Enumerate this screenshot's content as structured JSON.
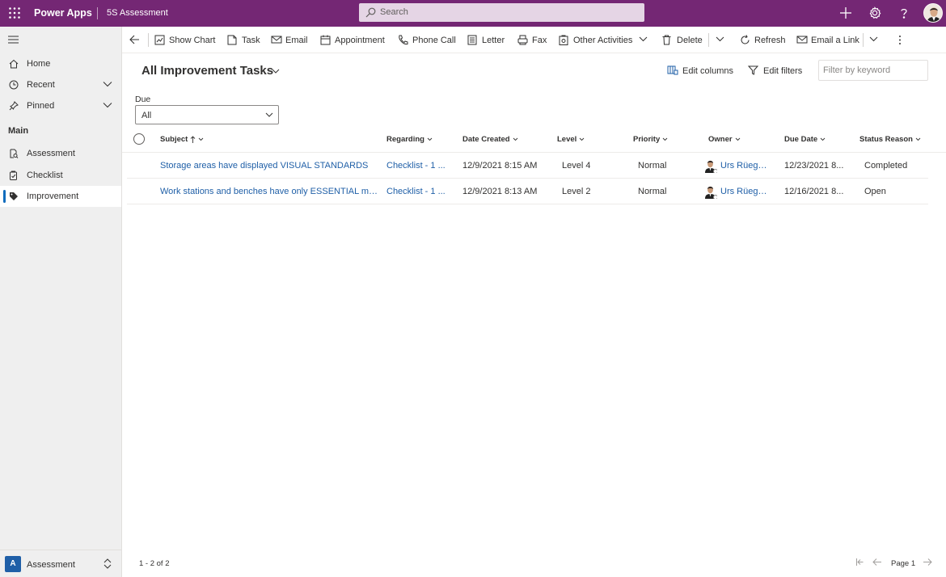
{
  "topbar": {
    "brand": "Power Apps",
    "app_name": "5S Assessment",
    "search_placeholder": "Search",
    "icons": [
      "waffle-icon",
      "plus-icon",
      "gear-icon",
      "help-icon",
      "avatar"
    ],
    "bg_color": "#742774"
  },
  "sidebar": {
    "items_top": [
      {
        "label": "Home",
        "icon": "home-icon"
      },
      {
        "label": "Recent",
        "icon": "clock-icon"
      },
      {
        "label": "Pinned",
        "icon": "pin-icon"
      }
    ],
    "group_label": "Main",
    "items_main": [
      {
        "label": "Assessment",
        "icon": "assessment-icon"
      },
      {
        "label": "Checklist",
        "icon": "checklist-icon"
      },
      {
        "label": "Improvement",
        "icon": "tag-icon",
        "active": true
      }
    ],
    "area": {
      "badge": "A",
      "label": "Assessment"
    }
  },
  "commands": [
    {
      "label": "Show Chart",
      "icon": "chart-icon"
    },
    {
      "label": "Task",
      "icon": "task-icon"
    },
    {
      "label": "Email",
      "icon": "email-icon"
    },
    {
      "label": "Appointment",
      "icon": "calendar-icon"
    },
    {
      "label": "Phone Call",
      "icon": "phone-icon"
    },
    {
      "label": "Letter",
      "icon": "letter-icon"
    },
    {
      "label": "Fax",
      "icon": "fax-icon"
    },
    {
      "label": "Other Activities",
      "icon": "activities-icon"
    },
    {
      "label": "Delete",
      "icon": "delete-icon"
    },
    {
      "label": "Refresh",
      "icon": "refresh-icon"
    },
    {
      "label": "Email a Link",
      "icon": "email-link-icon"
    }
  ],
  "view": {
    "title": "All Improvement Tasks",
    "edit_columns": "Edit columns",
    "edit_filters": "Edit filters",
    "filter_placeholder": "Filter by keyword",
    "due_label": "Due",
    "due_value": "All"
  },
  "grid": {
    "columns": [
      "Subject",
      "Regarding",
      "Date Created",
      "Level",
      "Priority",
      "Owner",
      "Due Date",
      "Status Reason"
    ],
    "rows": [
      {
        "subject": "Storage areas have displayed VISUAL STANDARDS",
        "regarding": "Checklist - 1 ...",
        "date_created": "12/9/2021 8:15 AM",
        "level": "Level 4",
        "priority": "Normal",
        "owner": "Urs Rüegg (...",
        "due_date": "12/23/2021 8...",
        "status": "Completed"
      },
      {
        "subject": "Work stations and benches have only ESSENTIAL mat...",
        "regarding": "Checklist - 1 ...",
        "date_created": "12/9/2021 8:13 AM",
        "level": "Level 2",
        "priority": "Normal",
        "owner": "Urs Rüegg (...",
        "due_date": "12/16/2021 8...",
        "status": "Open"
      }
    ]
  },
  "footer": {
    "count": "1 - 2 of 2",
    "page": "Page 1"
  }
}
